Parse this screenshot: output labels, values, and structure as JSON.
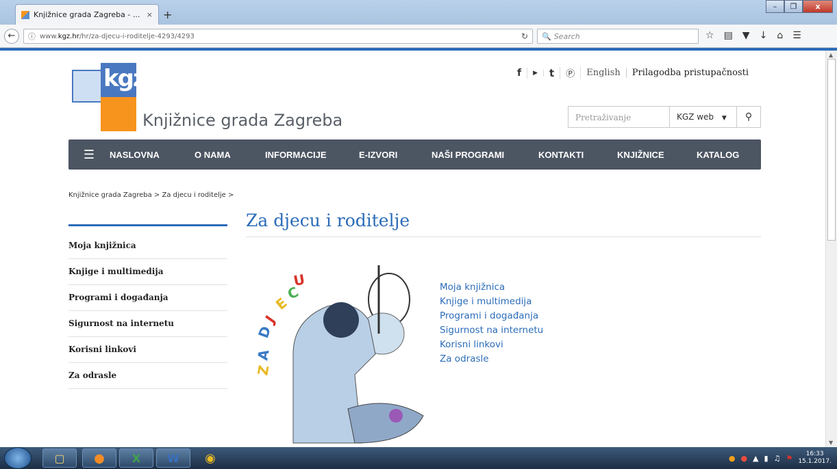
{
  "browser": {
    "tab_title": "Knjižnice grada Zagreba - ...",
    "tab_close": "×",
    "new_tab": "+",
    "url_prefix": "www.",
    "url_domain": "kgz.hr",
    "url_path": "/hr/za-djecu-i-roditelje-4293/4293",
    "search_placeholder": "Search",
    "window_buttons": [
      "–",
      "❐",
      "x"
    ]
  },
  "header": {
    "logo_text": "kgz",
    "site_name": "Knjižnice grada Zagreba",
    "social_icons": [
      "facebook-icon",
      "youtube-icon",
      "tumblr-icon",
      "pinterest-icon"
    ],
    "lang_link": "English",
    "accessibility_link": "Prilagodba pristupačnosti",
    "search_placeholder": "Pretraživanje",
    "search_scope": "KGZ web"
  },
  "menu": [
    "NASLOVNA",
    "O NAMA",
    "INFORMACIJE",
    "E-IZVORI",
    "NAŠI PROGRAMI",
    "KONTAKTI",
    "KNJIŽNICE",
    "KATALOG"
  ],
  "breadcrumb": {
    "item1": "Knjižnice grada Zagreba",
    "item2": "Za djecu i roditelje",
    "sep": ">"
  },
  "sidebar": [
    "Moja knjižnica",
    "Knjige i multimedija",
    "Programi i događanja",
    "Sigurnost na internetu",
    "Korisni linkovi",
    "Za odrasle"
  ],
  "main": {
    "title": "Za djecu i roditelje",
    "image_letters": "ZA DJECU",
    "links": [
      "Moja knjižnica",
      "Knjige i multimedija",
      "Programi i događanja",
      "Sigurnost na internetu",
      "Korisni linkovi",
      "Za odrasle"
    ]
  },
  "taskbar": {
    "time": "16:33",
    "date": "15.1.2017."
  }
}
